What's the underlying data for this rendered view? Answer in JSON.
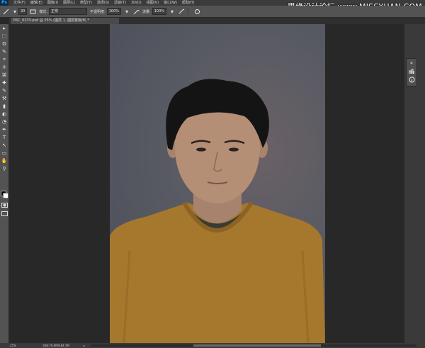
{
  "app": {
    "logo": "Ps",
    "menu": [
      "文件(F)",
      "编辑(E)",
      "图像(I)",
      "图层(L)",
      "类型(Y)",
      "选择(S)",
      "滤镜(T)",
      "3D(D)",
      "视图(V)",
      "窗口(W)",
      "帮助(H)"
    ],
    "watermark": "思缘设计论坛 www.MISSYUAN.COM"
  },
  "options": {
    "brush_size": "30",
    "mode_label": "模式:",
    "mode_value": "正常",
    "opacity_label": "不透明度:",
    "opacity_value": "100%",
    "flow_label": "流量:",
    "flow_value": "100%"
  },
  "document": {
    "tab_title": "DSC_0233.psd @ 25% (图层 1, 图层蒙版/8) *"
  },
  "tools": [
    "▸",
    "⬚",
    "ʘ",
    "✎",
    "⌗",
    "✛",
    "⌘",
    "✚",
    "✎",
    "⚒",
    "▮",
    "◐",
    "◔",
    "✒",
    "T",
    "↖",
    "▭",
    "✋",
    "⚲"
  ],
  "panels": {
    "collapse_icon": "double-chevron-icon",
    "icons": [
      "histogram-icon",
      "info-icon"
    ]
  },
  "status": {
    "zoom": "25%",
    "doc_info": "文档:78.9M/484.5M",
    "arrow": "▸"
  },
  "colors": {
    "sweater": "#a6782e",
    "background": "#56595f",
    "skin": "#b58e76",
    "hair": "#141414"
  }
}
